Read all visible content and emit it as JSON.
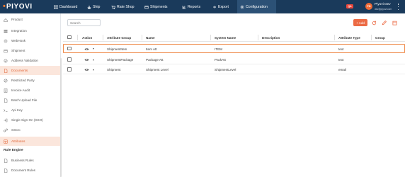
{
  "brand": {
    "name": "PIYOVI"
  },
  "nav": [
    {
      "label": "Dashboard",
      "icon": "dashboard-icon",
      "active": false
    },
    {
      "label": "Ship",
      "icon": "ship-icon",
      "active": false
    },
    {
      "label": "Rate Shop",
      "icon": "rate-shop-icon",
      "active": false
    },
    {
      "label": "Shipments",
      "icon": "shipments-icon",
      "active": false
    },
    {
      "label": "Reports",
      "icon": "reports-icon",
      "active": false
    },
    {
      "label": "Export",
      "icon": "export-icon",
      "active": false
    },
    {
      "label": "Configuration",
      "icon": "configuration-icon",
      "active": true
    }
  ],
  "header": {
    "env_badge": "QA",
    "user_initials": "PD",
    "user_name": "Piyovi Dev",
    "user_email": "dev@piyovi.com"
  },
  "sidebar": {
    "items": [
      {
        "label": "Product",
        "icon": "product-icon",
        "active": false
      },
      {
        "label": "Integration",
        "icon": "integration-icon",
        "active": false
      },
      {
        "label": "WebHook",
        "icon": "webhook-icon",
        "active": false
      },
      {
        "label": "Shipment",
        "icon": "shipment-icon",
        "active": false
      },
      {
        "label": "Address Validation",
        "icon": "address-validation-icon",
        "active": false
      },
      {
        "label": "Documents",
        "icon": "documents-icon",
        "active": true
      },
      {
        "label": "Restricted Party",
        "icon": "restricted-party-icon",
        "active": false
      },
      {
        "label": "Invoice Audit",
        "icon": "invoice-audit-icon",
        "active": false
      },
      {
        "label": "Batch Upload File",
        "icon": "batch-upload-icon",
        "active": false
      },
      {
        "label": "Api Key",
        "icon": "api-key-icon",
        "active": false
      },
      {
        "label": "Single Sign On (SSO)",
        "icon": "sso-icon",
        "active": false
      },
      {
        "label": "SSCC",
        "icon": "sscc-icon",
        "active": false
      },
      {
        "label": "Attributes",
        "icon": "attributes-icon",
        "active": true
      }
    ],
    "section_heading": "Rule Engine",
    "rule_items": [
      {
        "label": "Business Rules",
        "icon": "business-rules-icon",
        "active": false
      },
      {
        "label": "Document Rules",
        "icon": "document-rules-icon",
        "active": false
      }
    ]
  },
  "toolbar": {
    "search_placeholder": "Search",
    "add_label": "Add",
    "tools": [
      "refresh-icon",
      "edit-icon",
      "delete-icon"
    ]
  },
  "table": {
    "columns": [
      "Action",
      "Attribute Group",
      "Name",
      "System Name",
      "Description",
      "Attribute Type",
      "Group"
    ],
    "rows": [
      {
        "group": "ShipmentItem",
        "name": "Item Att",
        "system_name": "ITEM",
        "description": "",
        "type": "text",
        "attr_group": "",
        "highlighted": true
      },
      {
        "group": "ShipmentPackage",
        "name": "Package Att",
        "system_name": "PackAtt",
        "description": "",
        "type": "text",
        "attr_group": "",
        "highlighted": false
      },
      {
        "group": "Shipment",
        "name": "Shipment Level",
        "system_name": "ShipmentLevel",
        "description": "",
        "type": "email",
        "attr_group": "",
        "highlighted": false
      }
    ]
  },
  "colors": {
    "topbar": "#1a3a5b",
    "accent": "#ec6b45",
    "sidebar_active_bg": "#fbe6dc",
    "highlight_border": "#ef8a4a"
  }
}
